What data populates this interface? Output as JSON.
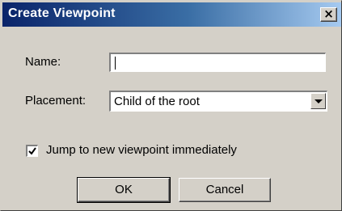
{
  "window": {
    "title": "Create Viewpoint",
    "close_icon": "close-icon",
    "close_glyph": "×"
  },
  "form": {
    "name_label": "Name:",
    "name_value": "",
    "placement_label": "Placement:",
    "placement_value": "Child of the root",
    "jump_checkbox_label": "Jump to new viewpoint immediately",
    "jump_checked": true
  },
  "buttons": {
    "ok_label": "OK",
    "cancel_label": "Cancel"
  }
}
